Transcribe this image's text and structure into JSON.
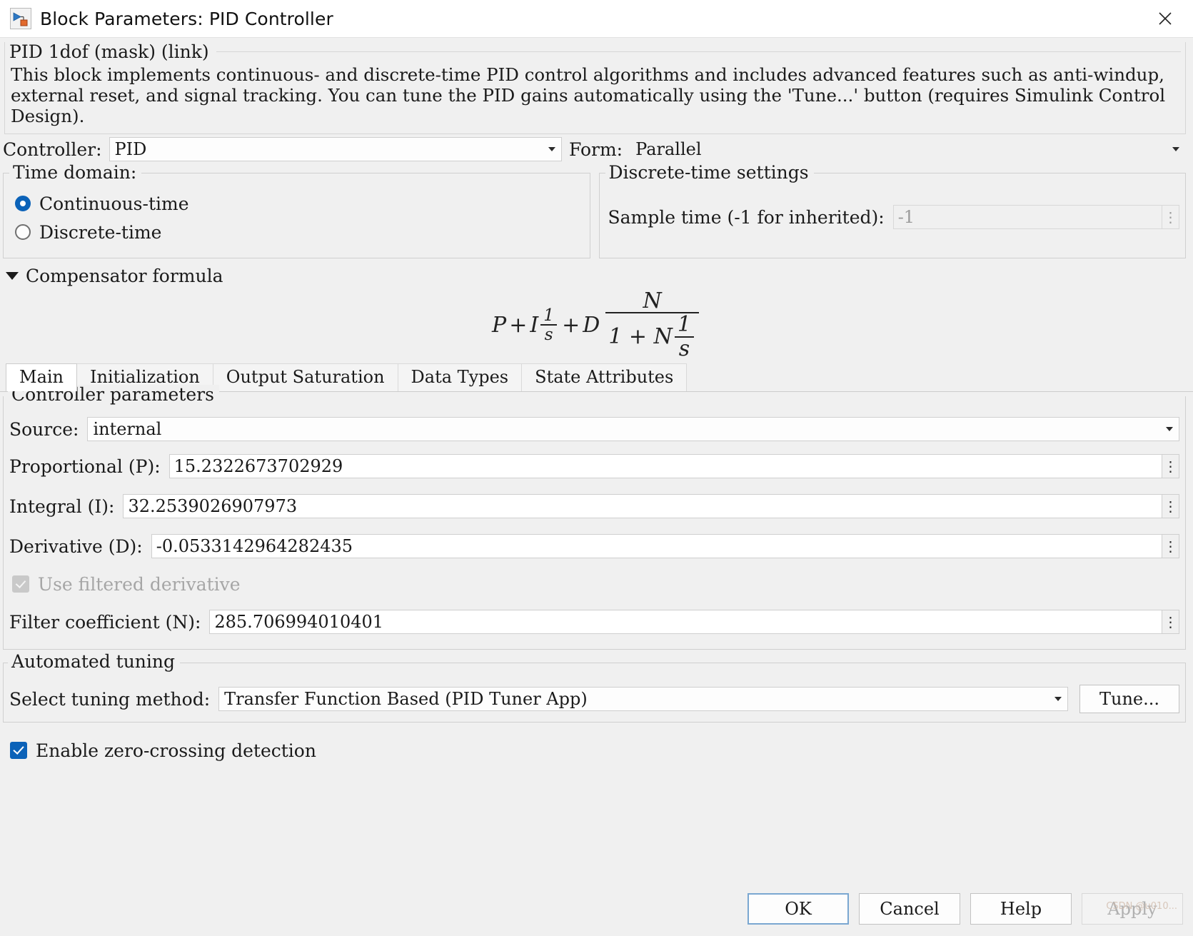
{
  "window": {
    "title": "Block Parameters: PID Controller",
    "icon": "simulink-block-icon",
    "close_label": "✕"
  },
  "mask": {
    "legend": "PID 1dof (mask) (link)",
    "description": "This block implements continuous- and discrete-time PID control algorithms and includes advanced features such as anti-windup, external reset, and signal tracking. You can tune the PID gains automatically using the 'Tune...' button (requires Simulink Control Design)."
  },
  "top": {
    "controller_label": "Controller:",
    "controller_value": "PID",
    "form_label": "Form:",
    "form_value": "Parallel"
  },
  "time_domain": {
    "legend": "Time domain:",
    "options": [
      {
        "label": "Continuous-time",
        "selected": true
      },
      {
        "label": "Discrete-time",
        "selected": false
      }
    ]
  },
  "discrete_settings": {
    "legend": "Discrete-time settings",
    "sample_time_label": "Sample time (-1 for inherited):",
    "sample_time_value": "-1",
    "spinner": "⋮"
  },
  "compensator": {
    "title": "Compensator formula",
    "expanded": true,
    "formula": {
      "p": "P",
      "plus1": "+",
      "i": "I",
      "i_num": "1",
      "i_den": "s",
      "plus2": "+",
      "d": "D",
      "d_num": "N",
      "d_den_lead": "1 + N",
      "d_den_num": "1",
      "d_den_den": "s"
    }
  },
  "tabs": [
    {
      "label": "Main",
      "active": true
    },
    {
      "label": "Initialization",
      "active": false
    },
    {
      "label": "Output Saturation",
      "active": false
    },
    {
      "label": "Data Types",
      "active": false
    },
    {
      "label": "State Attributes",
      "active": false
    }
  ],
  "controller_parameters": {
    "legend": "Controller parameters",
    "source_label": "Source:",
    "source_value": "internal",
    "proportional_label": "Proportional (P):",
    "proportional_value": "15.2322673702929",
    "integral_label": "Integral (I):",
    "integral_value": "32.2539026907973",
    "derivative_label": "Derivative (D):",
    "derivative_value": "-0.0533142964282435",
    "use_filtered_derivative_label": "Use filtered derivative",
    "use_filtered_derivative_checked": true,
    "use_filtered_derivative_enabled": false,
    "filter_coefficient_label": "Filter coefficient (N):",
    "filter_coefficient_value": "285.706994010401",
    "spinner": "⋮"
  },
  "automated_tuning": {
    "legend": "Automated tuning",
    "select_label": "Select tuning method:",
    "select_value": "Transfer Function Based (PID Tuner App)",
    "tune_button": "Tune..."
  },
  "zero_crossing": {
    "label": "Enable zero-crossing detection",
    "checked": true
  },
  "footer": {
    "ok": "OK",
    "cancel": "Cancel",
    "help": "Help",
    "apply": "Apply",
    "apply_enabled": false
  },
  "watermark": "CSDN @u010...",
  "colors": {
    "accent": "#0b62b8",
    "background": "#f0f0f0",
    "field": "#ffffff",
    "border": "#cfcfcf",
    "disabled_text": "#9b9b9b"
  }
}
